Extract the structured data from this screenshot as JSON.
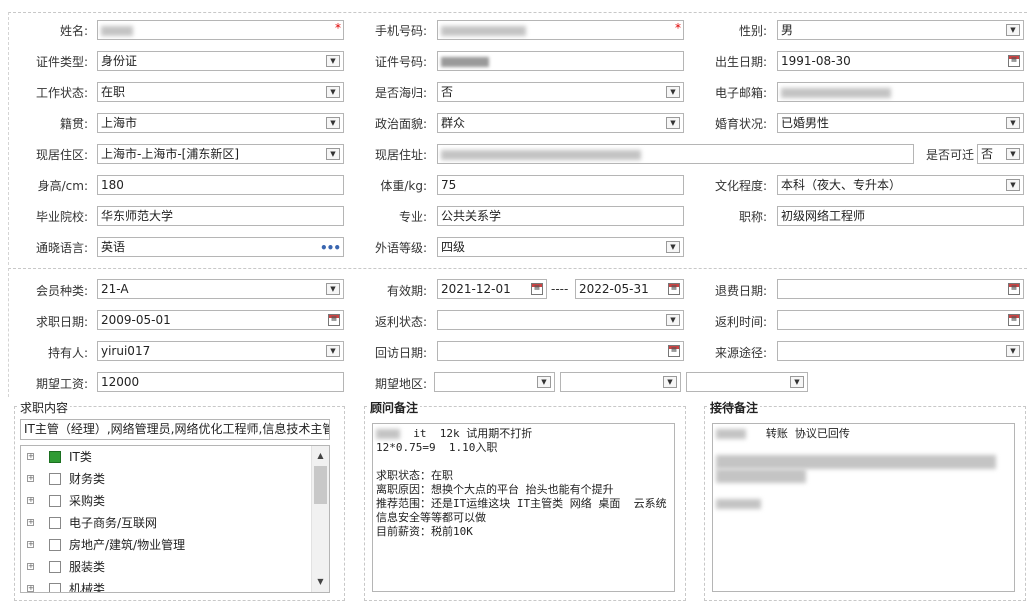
{
  "colors": {
    "required": "#e00000",
    "checked": "#2f9b34",
    "link_dots": "#3a66b0"
  },
  "basic": {
    "name_label": "姓名:",
    "phone_label": "手机号码:",
    "gender_label": "性别:",
    "gender_value": "男",
    "id_type_label": "证件类型:",
    "id_type_value": "身份证",
    "id_number_label": "证件号码:",
    "birth_label": "出生日期:",
    "birth_value": "1991-08-30",
    "work_status_label": "工作状态:",
    "work_status_value": "在职",
    "returnee_label": "是否海归:",
    "returnee_value": "否",
    "email_label": "电子邮箱:",
    "native_label": "籍贯:",
    "native_value": "上海市",
    "political_label": "政治面貌:",
    "political_value": "群众",
    "marital_label": "婚育状况:",
    "marital_value": "已婚男性",
    "residence_area_label": "现居住区:",
    "residence_area_value": "上海市-上海市-[浦东新区]",
    "address_label": "现居住址:",
    "relocate_label": "是否可迁",
    "relocate_value": "否",
    "height_label": "身高/cm:",
    "height_value": "180",
    "weight_label": "体重/kg:",
    "weight_value": "75",
    "education_label": "文化程度:",
    "education_value": "本科（夜大、专升本）",
    "school_label": "毕业院校:",
    "school_value": "华东师范大学",
    "major_label": "专业:",
    "major_value": "公共关系学",
    "title_label": "职称:",
    "title_value": "初级网络工程师",
    "language_label": "通晓语言:",
    "language_value": "英语",
    "lang_level_label": "外语等级:",
    "lang_level_value": "四级"
  },
  "member": {
    "type_label": "会员种类:",
    "type_value": "21-A",
    "validity_label": "有效期:",
    "validity_start": "2021-12-01",
    "validity_sep": "----",
    "validity_end": "2022-05-31",
    "refund_date_label": "退费日期:",
    "apply_date_label": "求职日期:",
    "apply_date_value": "2009-05-01",
    "rebate_status_label": "返利状态:",
    "rebate_time_label": "返利时间:",
    "holder_label": "持有人:",
    "holder_value": "yirui017",
    "visit_date_label": "回访日期:",
    "source_label": "来源途径:",
    "salary_label": "期望工资:",
    "salary_value": "12000",
    "region_label": "期望地区:"
  },
  "job": {
    "title": "求职内容",
    "summary": "IT主管（经理）,网络管理员,网络优化工程师,信息技术主管",
    "categories": [
      {
        "label": "IT类",
        "checked": true
      },
      {
        "label": "财务类",
        "checked": false
      },
      {
        "label": "采购类",
        "checked": false
      },
      {
        "label": "电子商务/互联网",
        "checked": false
      },
      {
        "label": "房地产/建筑/物业管理",
        "checked": false
      },
      {
        "label": "服装类",
        "checked": false
      },
      {
        "label": "机械类",
        "checked": false
      }
    ]
  },
  "consultant": {
    "title": "顾问备注",
    "line1": "it  12k 试用期不打折",
    "line2": "12*0.75=9  1.10入职",
    "line3": "求职状态：在职",
    "line4": "离职原因：想换个大点的平台 抬头也能有个提升",
    "line5": "推荐范围：还是IT运维这块 IT主管类 网络 桌面  云系统 信息安全等等都可以做",
    "line6": "目前薪资：税前10K"
  },
  "reception": {
    "title": "接待备注",
    "line1": "转账  协议已回传"
  }
}
